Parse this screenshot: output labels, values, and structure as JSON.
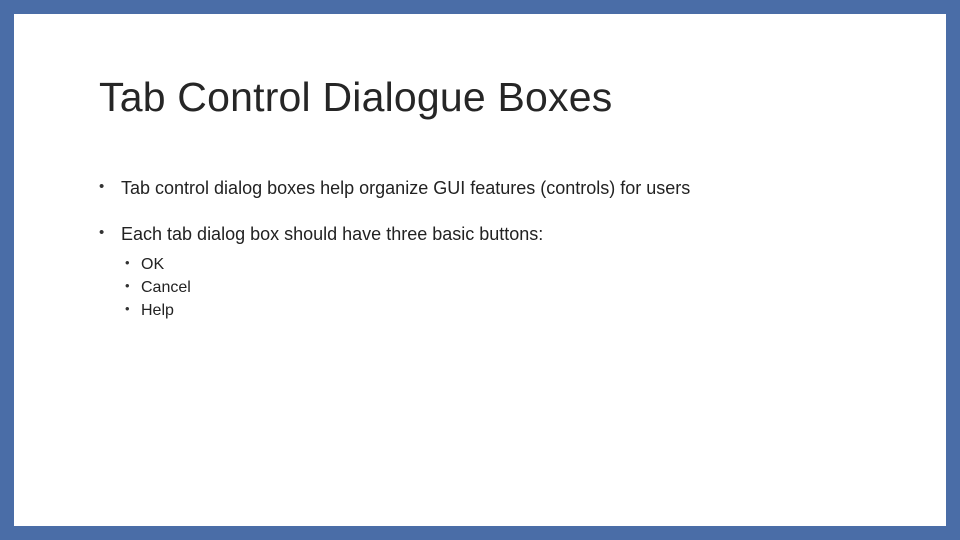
{
  "slide": {
    "title": "Tab Control Dialogue Boxes",
    "bullets": {
      "item0": "Tab control dialog boxes help organize GUI features (controls) for users",
      "item1": "Each tab dialog box should have three basic buttons:",
      "sub": {
        "s0": "OK",
        "s1": "Cancel",
        "s2": "Help"
      }
    }
  }
}
